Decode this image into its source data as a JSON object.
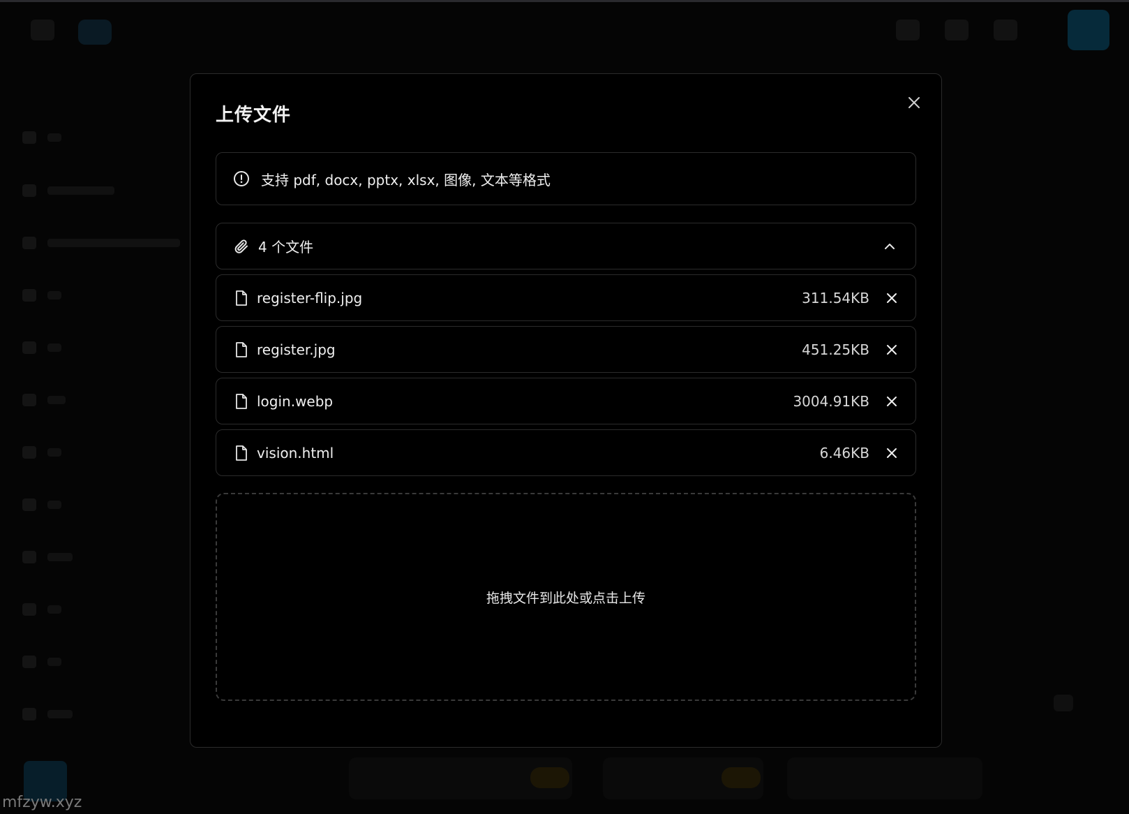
{
  "modal": {
    "title": "上传文件",
    "notice": "支持 pdf, docx, pptx, xlsx, 图像, 文本等格式",
    "files_header": "4 个文件",
    "dropzone_text": "拖拽文件到此处或点击上传"
  },
  "files": [
    {
      "name": "register-flip.jpg",
      "size": "311.54KB"
    },
    {
      "name": "register.jpg",
      "size": "451.25KB"
    },
    {
      "name": "login.webp",
      "size": "3004.91KB"
    },
    {
      "name": "vision.html",
      "size": "6.46KB"
    }
  ],
  "watermark": "mfzyw.xyz",
  "icons": {
    "notice": "info-circle-icon",
    "files_header": "paperclip-icon",
    "collapse": "chevron-up-icon",
    "file": "file-icon",
    "remove": "close-icon"
  }
}
